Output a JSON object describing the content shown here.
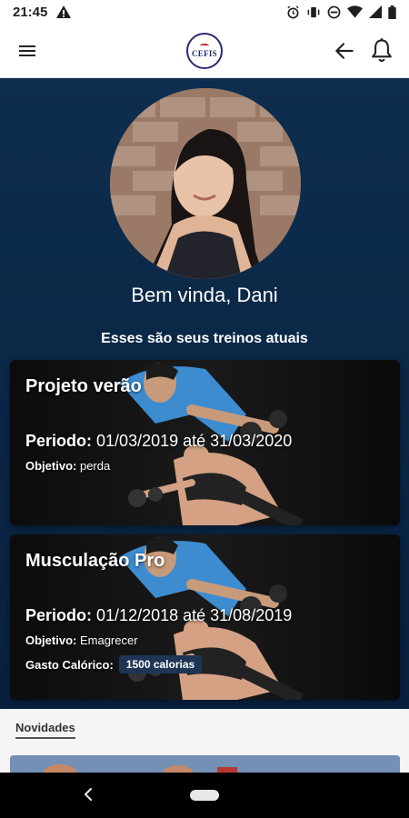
{
  "status_bar": {
    "time": "21:45",
    "icons": [
      "warning-icon",
      "alarm-icon",
      "vibrate-icon",
      "dnd-icon",
      "wifi-icon",
      "signal-icon",
      "battery-icon"
    ]
  },
  "app_bar": {
    "logo_text": "CEFIS",
    "icons": [
      "menu-icon",
      "back-arrow-icon",
      "bell-icon"
    ]
  },
  "hero": {
    "welcome": "Bem vinda, Dani",
    "subtitle": "Esses são seus treinos atuais"
  },
  "workouts": [
    {
      "title": "Projeto verão",
      "period_label": "Periodo:",
      "period_value": "01/03/2019 até 31/03/2020",
      "objective_label": "Objetivo:",
      "objective_value": "perda"
    },
    {
      "title": "Musculação Pro",
      "period_label": "Periodo:",
      "period_value": "01/12/2018 até 31/08/2019",
      "objective_label": "Objetivo:",
      "objective_value": "Emagrecer",
      "calorie_label": "Gasto Calórico:",
      "calorie_value": "1500 calorias"
    }
  ],
  "news": {
    "tab_label": "Novidades"
  },
  "colors": {
    "hero_bg": "#0b2847",
    "calorie_badge": "#1e3556",
    "brand_red": "#c8262c",
    "brand_blue": "#1d2d6b"
  }
}
